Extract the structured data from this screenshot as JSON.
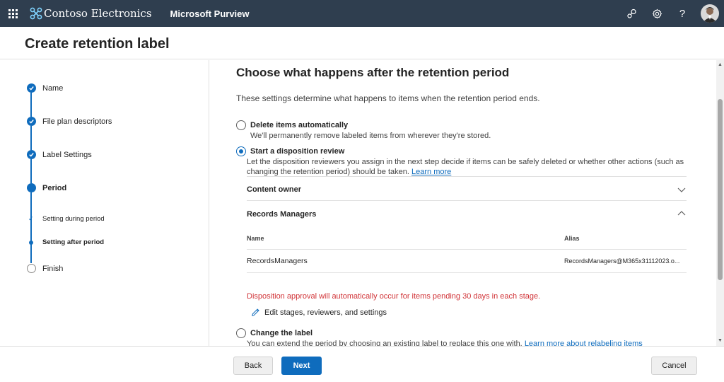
{
  "topbar": {
    "org_name": "Contoso Electronics",
    "product_name": "Microsoft Purview",
    "icons": [
      "app-launcher-icon",
      "org-logo-icon",
      "connections-icon",
      "settings-gear-icon",
      "help-icon",
      "user-avatar"
    ]
  },
  "page": {
    "title": "Create retention label"
  },
  "steps": [
    {
      "label": "Name",
      "state": "done"
    },
    {
      "label": "File plan descriptors",
      "state": "done"
    },
    {
      "label": "Label Settings",
      "state": "done"
    },
    {
      "label": "Period",
      "state": "current"
    },
    {
      "label": "Finish",
      "state": "pending"
    }
  ],
  "substeps": [
    {
      "label": "Setting during period",
      "state": "done"
    },
    {
      "label": "Setting after period",
      "state": "current"
    }
  ],
  "content": {
    "heading": "Choose what happens after the retention period",
    "intro": "These settings determine what happens to items when the retention period ends.",
    "options": {
      "delete": {
        "title": "Delete items automatically",
        "desc": "We'll permanently remove labeled items from wherever they're stored.",
        "selected": false
      },
      "disposition": {
        "title": "Start a disposition review",
        "desc_line1": "Let the disposition reviewers you assign in the next step decide if items can be safely deleted or whether other actions (such as",
        "desc_line2": "changing the retention period) should be taken.",
        "learn_more": "Learn more",
        "selected": true
      },
      "change_label": {
        "title": "Change the label",
        "desc": "You can extend the period by choosing an existing label to replace this one with.",
        "learn_more": "Learn more about relabeling items",
        "selected": false
      }
    },
    "stages": [
      {
        "title": "Content owner",
        "expanded": false
      },
      {
        "title": "Records Managers",
        "expanded": true
      }
    ],
    "reviewer_table": {
      "headers": [
        "Name",
        "Alias"
      ],
      "rows": [
        {
          "name": "RecordsManagers",
          "alias": "RecordsManagers@M365x31112023.o..."
        }
      ]
    },
    "warning": "Disposition approval will automatically occur for items pending 30 days in each stage.",
    "edit_link": "Edit stages, reviewers, and settings"
  },
  "footer": {
    "back": "Back",
    "next": "Next",
    "cancel": "Cancel"
  },
  "colors": {
    "topbar": "#2f3e4f",
    "accent": "#0f6cbd",
    "warning": "#d13438"
  }
}
